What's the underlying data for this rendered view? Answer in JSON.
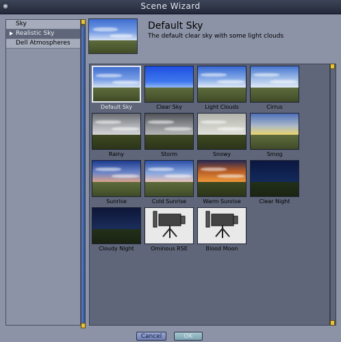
{
  "window": {
    "title": "Scene Wizard"
  },
  "categories": [
    {
      "label": "Sky",
      "selected": false
    },
    {
      "label": "Realistic Sky",
      "selected": true
    },
    {
      "label": "Dell Atmospheres",
      "selected": false
    }
  ],
  "header": {
    "title": "Default Sky",
    "description": "The default clear sky with some light clouds"
  },
  "presets": [
    {
      "label": "Default Sky",
      "style": "s-default",
      "ground": "normal",
      "selected": true
    },
    {
      "label": "Clear Sky",
      "style": "s-clear",
      "ground": "normal",
      "selected": false
    },
    {
      "label": "Light Clouds",
      "style": "s-light",
      "ground": "normal",
      "selected": false
    },
    {
      "label": "Cirrus",
      "style": "s-cirrus",
      "ground": "normal",
      "selected": false
    },
    {
      "label": "Rainy",
      "style": "s-rainy",
      "ground": "dark",
      "selected": false
    },
    {
      "label": "Storm",
      "style": "s-storm",
      "ground": "dark",
      "selected": false
    },
    {
      "label": "Snowy",
      "style": "s-snowy",
      "ground": "dark",
      "selected": false
    },
    {
      "label": "Smog",
      "style": "s-smog",
      "ground": "normal",
      "selected": false
    },
    {
      "label": "Sunrise",
      "style": "s-sunrise",
      "ground": "normal",
      "selected": false
    },
    {
      "label": "Cold Sunrise",
      "style": "s-coldsun",
      "ground": "normal",
      "selected": false
    },
    {
      "label": "Warm Sunrise",
      "style": "s-warm",
      "ground": "dark",
      "selected": false
    },
    {
      "label": "Clear Night",
      "style": "s-clearnight",
      "ground": "night",
      "selected": false
    },
    {
      "label": "Cloudy Night",
      "style": "s-cloudynight",
      "ground": "night",
      "selected": false
    },
    {
      "label": "Ominous RSE",
      "style": "camera",
      "ground": "none",
      "selected": false
    },
    {
      "label": "Blood Moon",
      "style": "camera",
      "ground": "none",
      "selected": false
    }
  ],
  "buttons": {
    "cancel": "Cancel",
    "ok": "OK"
  },
  "colors": {
    "background": "#8c93a6",
    "titlebar": "#2a3142",
    "selection": "#5f6679",
    "scroll_thumb": "#3e5fa8",
    "scroll_cap": "#e8c23a"
  },
  "icons": {
    "close": "close-icon",
    "disclosure": "triangle-right-icon",
    "placeholder": "camera-icon"
  }
}
